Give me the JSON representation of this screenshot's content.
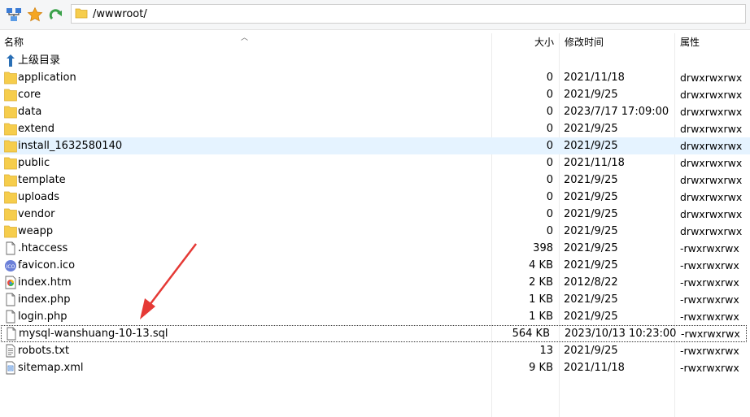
{
  "toolbar": {
    "path": "/wwwroot/",
    "buttons": [
      "site-manager-icon",
      "bookmark-star-icon",
      "refresh-icon"
    ]
  },
  "columns": {
    "name": "名称",
    "size": "大小",
    "modified": "修改时间",
    "permissions": "属性"
  },
  "parent": {
    "label": "上级目录"
  },
  "files": [
    {
      "name": "application",
      "size": "0",
      "date": "2021/11/18",
      "perm": "drwxrwxrwx",
      "icon": "folder-icon"
    },
    {
      "name": "core",
      "size": "0",
      "date": "2021/9/25",
      "perm": "drwxrwxrwx",
      "icon": "folder-icon"
    },
    {
      "name": "data",
      "size": "0",
      "date": "2023/7/17 17:09:00",
      "perm": "drwxrwxrwx",
      "icon": "folder-icon"
    },
    {
      "name": "extend",
      "size": "0",
      "date": "2021/9/25",
      "perm": "drwxrwxrwx",
      "icon": "folder-icon"
    },
    {
      "name": "install_1632580140",
      "size": "0",
      "date": "2021/9/25",
      "perm": "drwxrwxrwx",
      "icon": "folder-icon"
    },
    {
      "name": "public",
      "size": "0",
      "date": "2021/11/18",
      "perm": "drwxrwxrwx",
      "icon": "folder-icon"
    },
    {
      "name": "template",
      "size": "0",
      "date": "2021/9/25",
      "perm": "drwxrwxrwx",
      "icon": "folder-icon"
    },
    {
      "name": "uploads",
      "size": "0",
      "date": "2021/9/25",
      "perm": "drwxrwxrwx",
      "icon": "folder-icon"
    },
    {
      "name": "vendor",
      "size": "0",
      "date": "2021/9/25",
      "perm": "drwxrwxrwx",
      "icon": "folder-icon"
    },
    {
      "name": "weapp",
      "size": "0",
      "date": "2021/9/25",
      "perm": "drwxrwxrwx",
      "icon": "folder-icon"
    },
    {
      "name": ".htaccess",
      "size": "398",
      "date": "2021/9/25",
      "perm": "-rwxrwxrwx",
      "icon": "file-icon"
    },
    {
      "name": "favicon.ico",
      "size": "4 KB",
      "date": "2021/9/25",
      "perm": "-rwxrwxrwx",
      "icon": "ico-file-icon"
    },
    {
      "name": "index.htm",
      "size": "2 KB",
      "date": "2012/8/22",
      "perm": "-rwxrwxrwx",
      "icon": "html-file-icon"
    },
    {
      "name": "index.php",
      "size": "1 KB",
      "date": "2021/9/25",
      "perm": "-rwxrwxrwx",
      "icon": "file-icon"
    },
    {
      "name": "login.php",
      "size": "1 KB",
      "date": "2021/9/25",
      "perm": "-rwxrwxrwx",
      "icon": "file-icon"
    },
    {
      "name": "mysql-wanshuang-10-13.sql",
      "size": "564 KB",
      "date": "2023/10/13 10:23:00",
      "perm": "-rwxrwxrwx",
      "icon": "file-icon"
    },
    {
      "name": "robots.txt",
      "size": "13",
      "date": "2021/9/25",
      "perm": "-rwxrwxrwx",
      "icon": "text-file-icon"
    },
    {
      "name": "sitemap.xml",
      "size": "9 KB",
      "date": "2021/11/18",
      "perm": "-rwxrwxrwx",
      "icon": "xml-file-icon"
    }
  ],
  "state": {
    "hovered_row": "install_1632580140",
    "focused_row": "mysql-wanshuang-10-13.sql"
  },
  "colors": {
    "accent_arrow": "#e53935",
    "hover": "#e5f3ff",
    "folder": "#f4c430"
  }
}
